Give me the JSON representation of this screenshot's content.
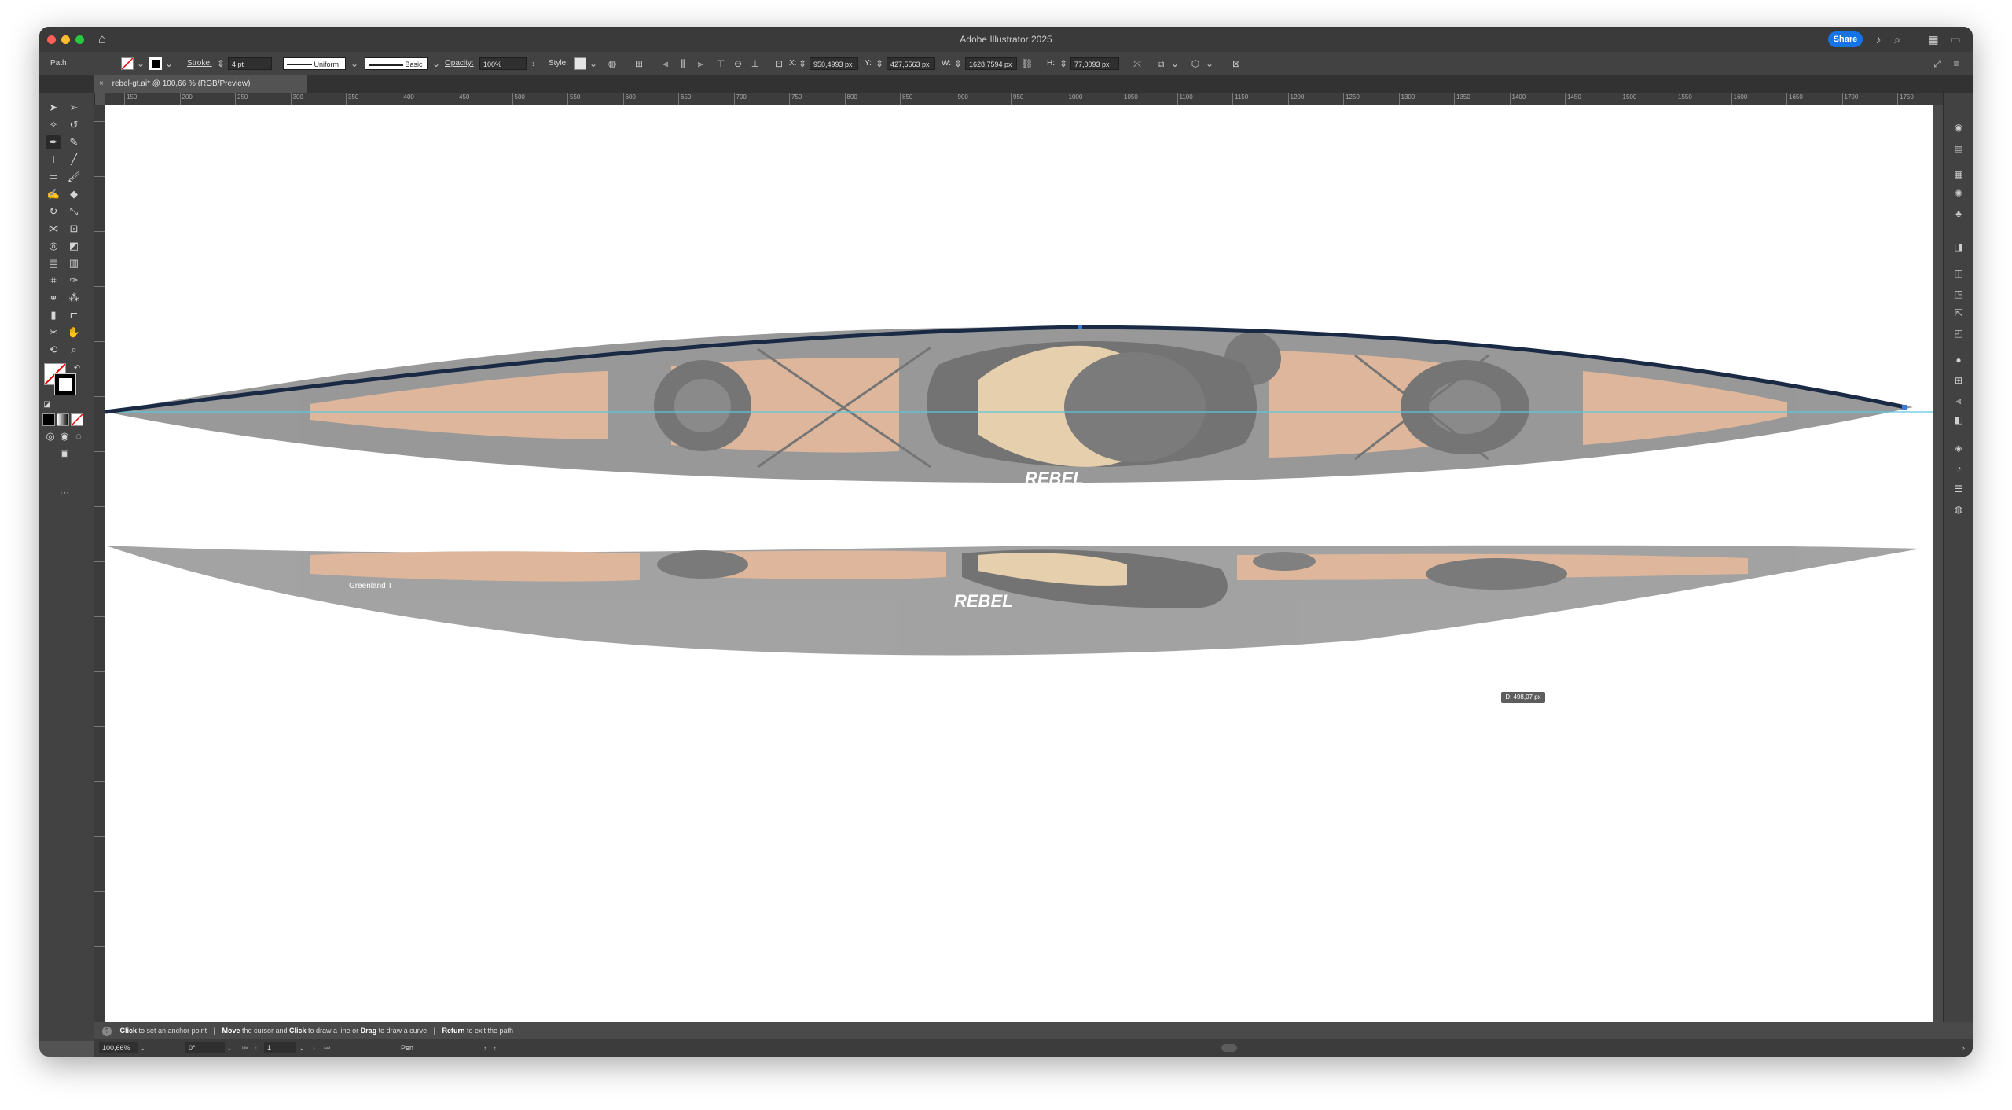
{
  "app": {
    "title": "Adobe Illustrator 2025",
    "share_label": "Share"
  },
  "control_bar": {
    "selection_type": "Path",
    "stroke_label": "Stroke:",
    "stroke_weight": "4 pt",
    "profile": "Uniform",
    "brush": "Basic",
    "opacity_label": "Opacity:",
    "opacity_value": "100%",
    "style_label": "Style:",
    "x_label": "X:",
    "x_value": "950,4993 px",
    "y_label": "Y:",
    "y_value": "427,5563 px",
    "w_label": "W:",
    "w_value": "1628,7594 px",
    "h_label": "H:",
    "h_value": "77,0093 px"
  },
  "document_tab": {
    "close": "×",
    "title": "rebel-gt.ai* @ 100,66 % (RGB/Preview)"
  },
  "ruler_labels": [
    "150",
    "200",
    "250",
    "300",
    "350",
    "400",
    "450",
    "500",
    "550",
    "600",
    "650",
    "700",
    "750",
    "800",
    "850",
    "900",
    "950",
    "1000",
    "1050",
    "1100",
    "1150",
    "1200",
    "1250",
    "1300",
    "1350",
    "1400",
    "1450",
    "1500",
    "1550",
    "1600",
    "1650",
    "1700",
    "1750"
  ],
  "canvas": {
    "tooltip": "D: 498,07 px",
    "logo_text": "REBEL",
    "model_text": "Greenland T"
  },
  "status": {
    "part1_bold": "Click",
    "part1": " to set an anchor point",
    "sep": "|",
    "part2_bold": "Move",
    "part2": " the cursor and ",
    "part3_bold": "Click",
    "part3": " to draw a line or ",
    "part4_bold": "Drag",
    "part4": " to draw a curve",
    "part5_bold": "Return",
    "part5": " to exit the path"
  },
  "bottom_bar": {
    "zoom": "100,66%",
    "rotation": "0°",
    "artboard": "1",
    "tool": "Pen"
  },
  "colors": {
    "accent": "#1473e6",
    "path_stroke": "#1a2a44",
    "guide": "#5ac8e0",
    "wood": "#c98a5e",
    "hull": "#7a7a7a"
  }
}
